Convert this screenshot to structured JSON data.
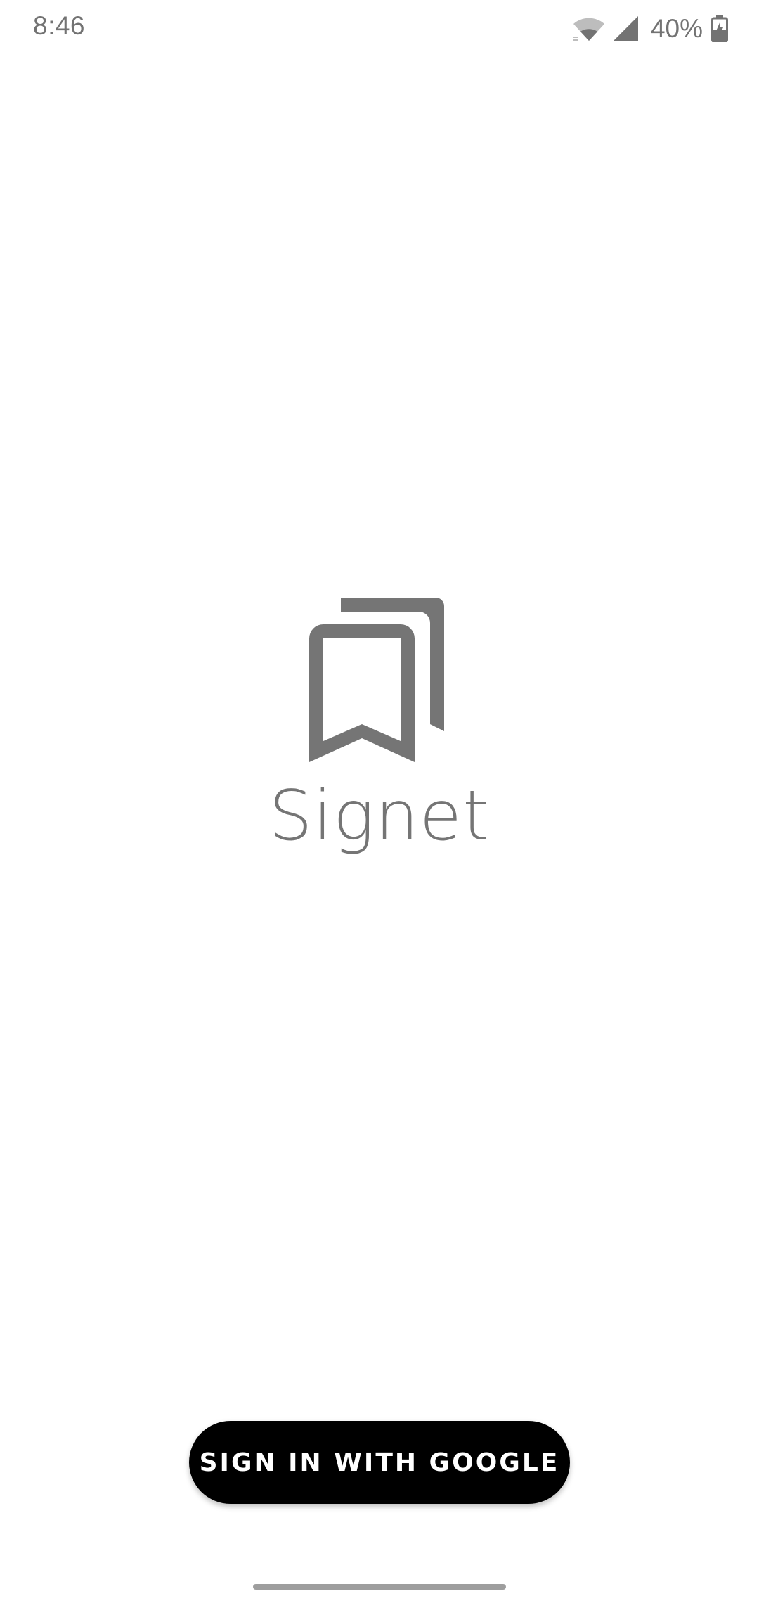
{
  "status_bar": {
    "time": "8:46",
    "battery_percent": "40%",
    "icons": [
      "wifi-icon",
      "cell-signal-icon",
      "battery-charging-icon"
    ]
  },
  "app": {
    "name": "Signet",
    "logo_icon": "bookmarks-icon"
  },
  "sign_in": {
    "label": "SIGN IN WITH GOOGLE"
  },
  "colors": {
    "logo_gray": "#757575",
    "button_bg": "#000000",
    "button_text": "#ffffff",
    "status_text": "#737373"
  }
}
